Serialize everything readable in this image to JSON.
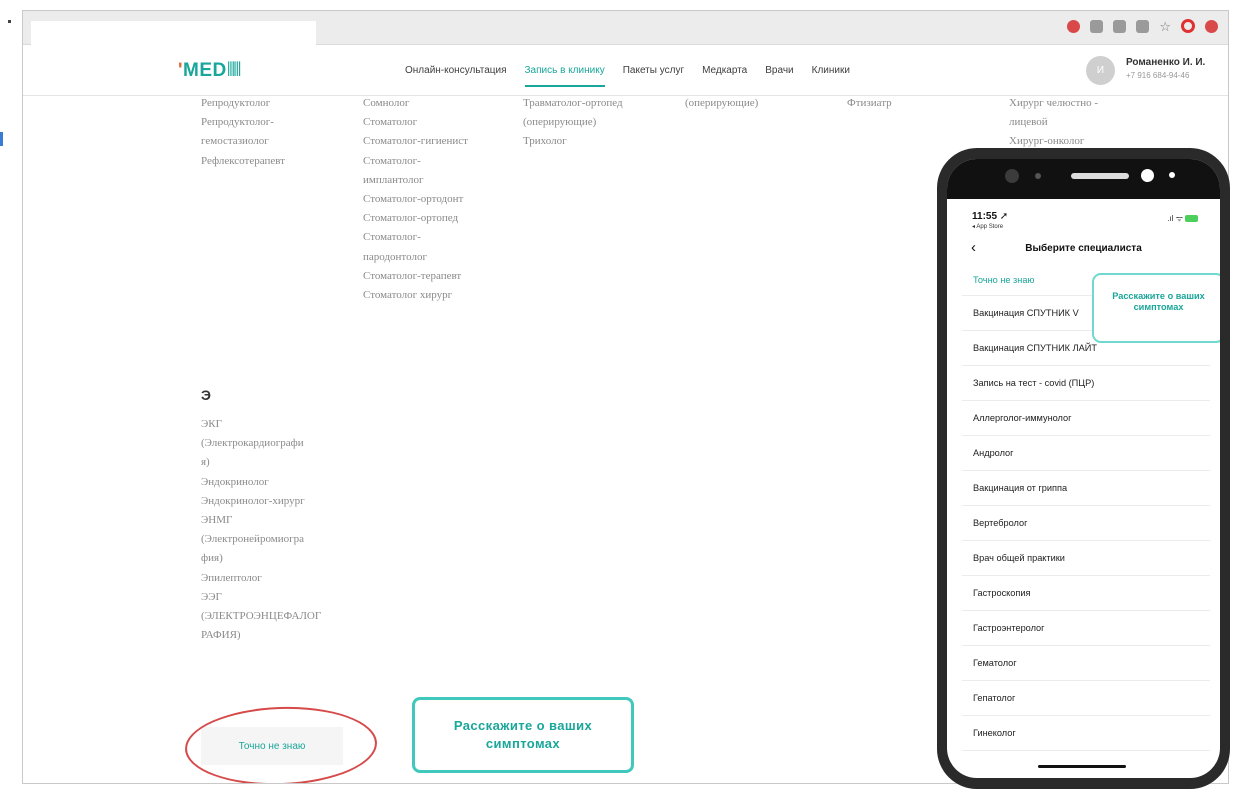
{
  "header": {
    "logo_text": "MED",
    "nav": [
      "Онлайн-консультация",
      "Запись в клинику",
      "Пакеты услуг",
      "Медкарта",
      "Врачи",
      "Клиники"
    ],
    "active_nav": "Запись в клинику",
    "user": {
      "initials": "И",
      "name": "Романенко И. И.",
      "phone": "+7 916 684-94-46"
    }
  },
  "columns": {
    "col1": [
      "Репродуктолог",
      "Репродуктолог-",
      "гемостазиолог",
      "Рефлексотерапевт"
    ],
    "col2": [
      "Сомнолог",
      "Стоматолог",
      "Стоматолог-гигиенист",
      "Стоматолог-",
      "имплантолог",
      "Стоматолог-ортодонт",
      "Стоматолог-ортопед",
      "Стоматолог-",
      "пародонтолог",
      "Стоматолог-терапевт",
      "Стоматолог хирург"
    ],
    "col3": [
      "Травматолог-ортопед",
      "(оперирующие)",
      "Трихолог"
    ],
    "col4": [
      "(оперирующие)"
    ],
    "col5": [
      "Фтизиатр"
    ],
    "col6": [
      "Хирург челюстно -",
      "лицевой",
      "Хирург-онколог"
    ],
    "section_letter": "Э",
    "col_e": [
      "ЭКГ",
      "(Электрокардиографи",
      "я)",
      "Эндокринолог",
      "Эндокринолог-хирург",
      "ЭНМГ",
      "(Электронейромиогра",
      "фия)",
      "Эпилептолог",
      "ЭЭГ",
      "(ЭЛЕКТРОЭНЦЕФАЛОГ",
      "РАФИЯ)"
    ]
  },
  "buttons": {
    "dont_know": "Точно не знаю",
    "tell_symptoms": "Расскажите о ваших симптомах"
  },
  "mobile": {
    "time": "11:55",
    "back_app": "◂ App Store",
    "title": "Выберите специалиста",
    "first_item": "Точно не знаю",
    "symptoms_button": "Расскажите о ваших симптомах",
    "items": [
      "Вакцинация СПУТНИК V",
      "Вакцинация СПУТНИК ЛАЙТ",
      "Запись на тест - covid (ПЦР)",
      "Аллерголог-иммунолог",
      "Андролог",
      "Вакцинация от гриппа",
      "Вертебролог",
      "Врач общей практики",
      "Гастроскопия",
      "Гастроэнтеролог",
      "Гематолог",
      "Гепатолог",
      "Гинеколог"
    ]
  },
  "colors": {
    "accent": "#1aa69a",
    "highlight_red": "#d64a4a",
    "button_border": "#3fc8bb"
  }
}
